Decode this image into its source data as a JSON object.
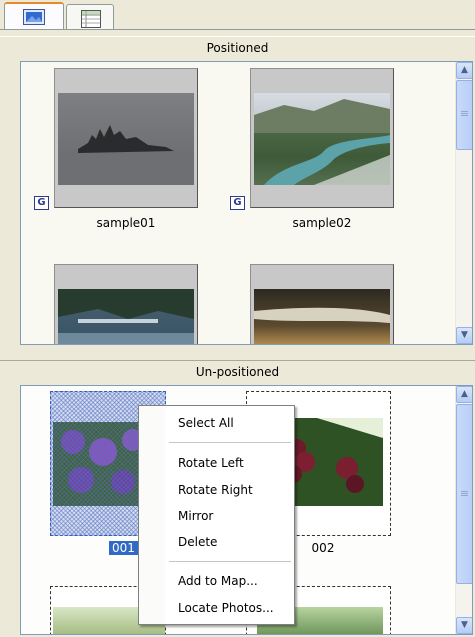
{
  "tabs": [
    {
      "icon": "photo-icon",
      "active": true
    },
    {
      "icon": "list-grid-icon",
      "active": false
    }
  ],
  "sections": {
    "positioned": "Positioned",
    "unpositioned": "Un-positioned"
  },
  "positioned_photos": [
    {
      "caption": "sample01",
      "geo_badge": "G"
    },
    {
      "caption": "sample02",
      "geo_badge": "G"
    }
  ],
  "unpositioned_photos": [
    {
      "caption": "001",
      "selected": true
    },
    {
      "caption": "002",
      "selected": false
    }
  ],
  "context_menu": {
    "select_all": "Select All",
    "rotate_left": "Rotate Left",
    "rotate_right": "Rotate Right",
    "mirror": "Mirror",
    "delete": "Delete",
    "add_to_map": "Add to Map...",
    "locate_photos": "Locate Photos..."
  },
  "colors": {
    "selection": "#316ac5",
    "window_bg": "#ece9d8",
    "active_tab_accent": "#e68b2c"
  }
}
